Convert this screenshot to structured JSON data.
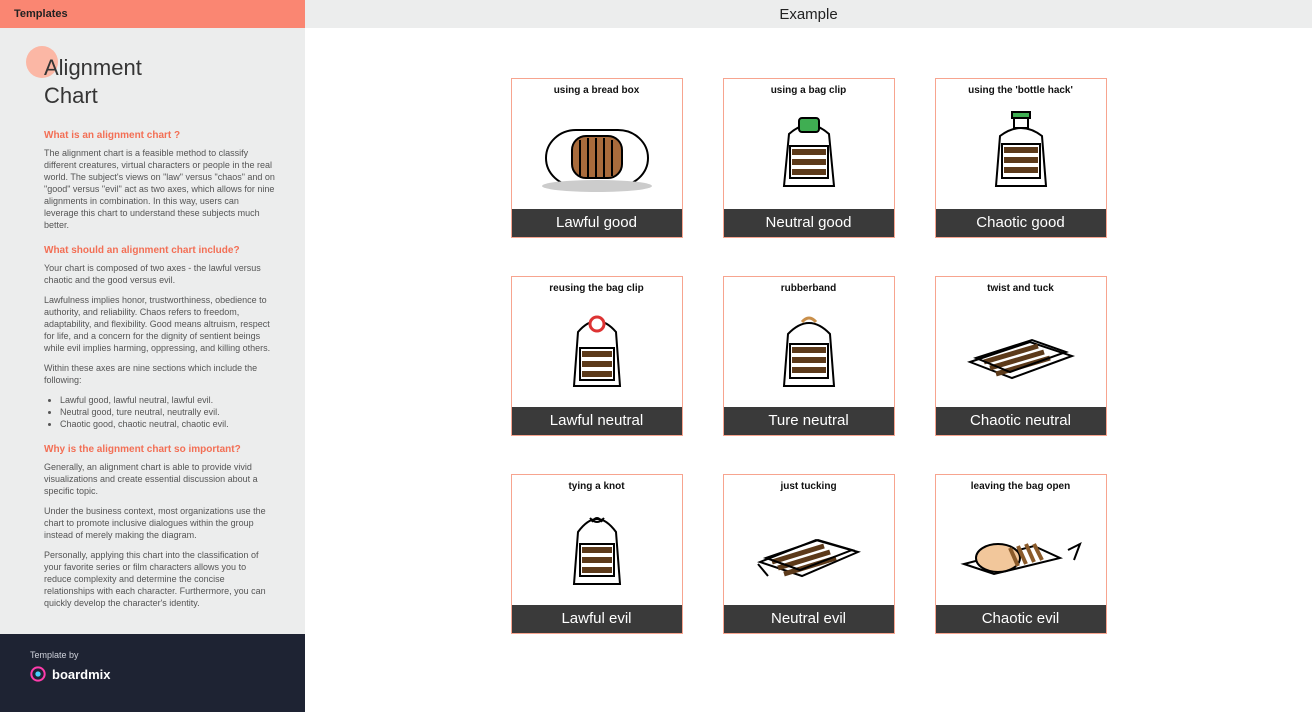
{
  "sidebar": {
    "tab_label": "Templates",
    "title_line1": "Alignment",
    "title_line2": "Chart",
    "sections": {
      "s1": {
        "heading": "What is an alignment chart ?",
        "p1": "The alignment chart is a feasible method to classify different creatures, virtual characters or people in the real world. The subject's views on \"law\" versus \"chaos\" and on \"good\" versus \"evil\" act as two axes, which allows for nine alignments in combination. In this way, users can leverage this chart to understand these subjects much better."
      },
      "s2": {
        "heading": "What should an alignment chart include?",
        "p1": "Your chart is composed of two axes - the lawful versus chaotic and the good versus evil.",
        "p2": "Lawfulness implies honor, trustworthiness, obedience to authority, and reliability. Chaos refers to freedom, adaptability, and flexibility. Good means altruism, respect for life, and a concern for the dignity of sentient beings while evil implies harming, oppressing, and killing others.",
        "p3": "Within these axes are nine sections which include the following:",
        "li1": "Lawful good, lawful neutral, lawful evil.",
        "li2": "Neutral good, ture neutral, neutrally evil.",
        "li3": "Chaotic good, chaotic neutral, chaotic evil."
      },
      "s3": {
        "heading": "Why is the alignment chart so important?",
        "p1": "Generally, an alignment chart is able to provide vivid visualizations and create essential discussion about a specific topic.",
        "p2": "Under the business context, most organizations use the chart to promote inclusive dialogues within the group instead of merely making the diagram.",
        "p3": "Personally, applying this chart into the classification of your favorite series or film characters allows you to reduce complexity and determine the concise relationships with each character. Furthermore, you can quickly develop the character's identity."
      }
    },
    "footer": {
      "label": "Template by",
      "brand": "boardmix"
    }
  },
  "main": {
    "header": "Example",
    "cells": [
      {
        "caption": "using a bread box",
        "label": "Lawful good"
      },
      {
        "caption": "using a bag clip",
        "label": "Neutral good"
      },
      {
        "caption": "using the 'bottle hack'",
        "label": "Chaotic good"
      },
      {
        "caption": "reusing the bag clip",
        "label": "Lawful neutral"
      },
      {
        "caption": "rubberband",
        "label": "Ture neutral"
      },
      {
        "caption": "twist and tuck",
        "label": "Chaotic neutral"
      },
      {
        "caption": "tying a knot",
        "label": "Lawful evil"
      },
      {
        "caption": "just tucking",
        "label": "Neutral evil"
      },
      {
        "caption": "leaving the bag open",
        "label": "Chaotic evil"
      }
    ]
  }
}
